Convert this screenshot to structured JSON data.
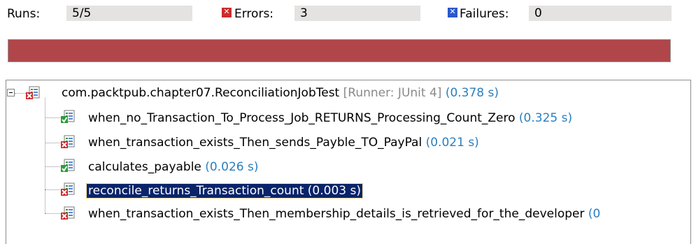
{
  "counters": {
    "runs_label": "Runs:",
    "runs_value": "5/5",
    "errors_label": "Errors:",
    "errors_value": "3",
    "failures_label": "Failures:",
    "failures_value": "0"
  },
  "progress": {
    "status": "error",
    "fraction": 1.0,
    "color": "#b0464a"
  },
  "tree": {
    "suite": {
      "name": "com.packtpub.chapter07.ReconciliationJobTest",
      "runner": "[Runner: JUnit 4]",
      "time": "(0.378 s)",
      "status": "error",
      "expanded": true
    },
    "tests": [
      {
        "name": "when_no_Transaction_To_Process_Job_RETURNS_Processing_Count_Zero",
        "time": "(0.325 s)",
        "status": "pass"
      },
      {
        "name": "when_transaction_exists_Then_sends_Payble_TO_PayPal",
        "time": "(0.021 s)",
        "status": "error"
      },
      {
        "name": "calculates_payable",
        "time": "(0.026 s)",
        "status": "pass"
      },
      {
        "name": "reconcile_returns_Transaction_count (0.003 s)",
        "time": "",
        "status": "error",
        "selected": true
      },
      {
        "name": "when_transaction_exists_Then_membership_details_is_retrieved_for_the_developer",
        "time": "(0",
        "status": "error"
      }
    ]
  },
  "colors": {
    "error": "#cc2b2b",
    "pass": "#2e9b3a",
    "time": "#2a7fbf",
    "selection": "#0a246a"
  },
  "icons": {
    "error": "error-icon",
    "failure": "failure-icon",
    "suite": "test-suite-icon",
    "test": "test-case-icon"
  }
}
